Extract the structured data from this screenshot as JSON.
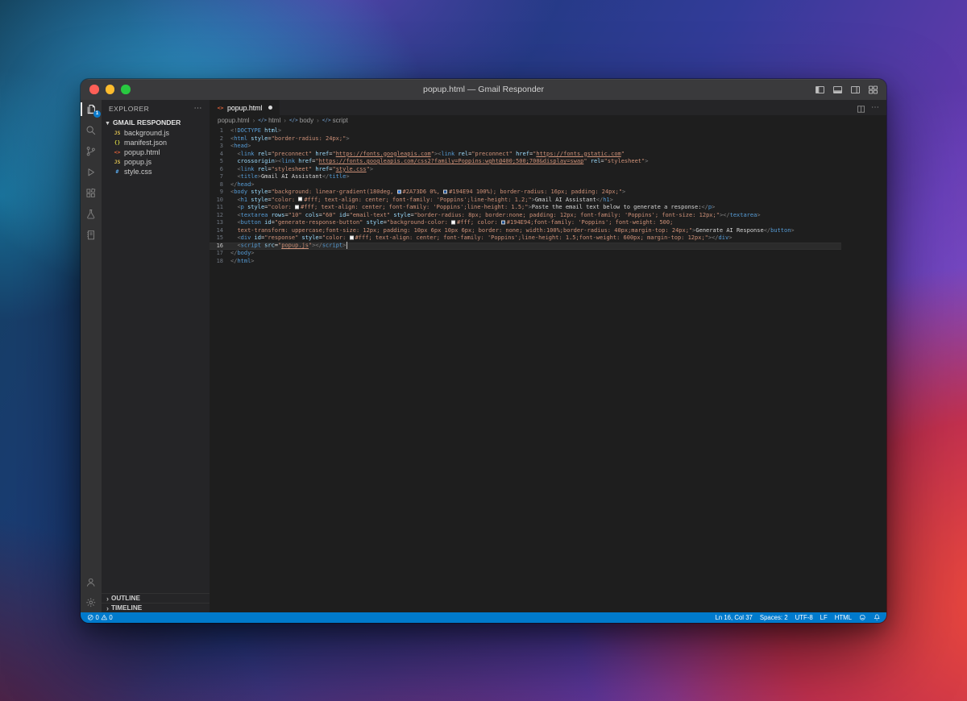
{
  "window": {
    "title": "popup.html — Gmail Responder"
  },
  "titlebar_icons": [
    "layout-sidebar-left",
    "layout-panel",
    "layout-sidebar-right",
    "layout-customize"
  ],
  "activity_bar": {
    "badge": "1",
    "items": [
      "explorer",
      "search",
      "source-control",
      "run-debug",
      "extensions",
      "testing",
      "notebook"
    ],
    "bottom_items": [
      "account",
      "settings"
    ]
  },
  "explorer": {
    "header": "EXPLORER",
    "section": "GMAIL RESPONDER",
    "files": [
      {
        "name": "background.js",
        "type": "js"
      },
      {
        "name": "manifest.json",
        "type": "json"
      },
      {
        "name": "popup.html",
        "type": "html"
      },
      {
        "name": "popup.js",
        "type": "js"
      },
      {
        "name": "style.css",
        "type": "css"
      }
    ],
    "bottom_sections": [
      "OUTLINE",
      "TIMELINE"
    ]
  },
  "editor": {
    "tab": {
      "label": "popup.html",
      "modified": true,
      "icon": "html"
    },
    "breadcrumb": [
      "popup.html",
      "html",
      "body",
      "script"
    ],
    "active_line": 16,
    "lines": [
      [
        {
          "c": "pu",
          "t": "<!"
        },
        {
          "c": "tg",
          "t": "DOCTYPE"
        },
        {
          "c": "at",
          "t": " html"
        },
        {
          "c": "pu",
          "t": ">"
        }
      ],
      [
        {
          "c": "pu",
          "t": "<"
        },
        {
          "c": "tg",
          "t": "html"
        },
        {
          "c": "at",
          "t": " style"
        },
        {
          "c": "tx",
          "t": "="
        },
        {
          "c": "st",
          "t": "\"border-radius: 24px;\""
        },
        {
          "c": "pu",
          "t": ">"
        }
      ],
      [
        {
          "c": "pu",
          "t": "<"
        },
        {
          "c": "tg",
          "t": "head"
        },
        {
          "c": "pu",
          "t": ">"
        }
      ],
      [
        {
          "c": "tx",
          "t": "  "
        },
        {
          "c": "pu",
          "t": "<"
        },
        {
          "c": "tg",
          "t": "link"
        },
        {
          "c": "at",
          "t": " rel"
        },
        {
          "c": "tx",
          "t": "="
        },
        {
          "c": "st",
          "t": "\"preconnect\""
        },
        {
          "c": "at",
          "t": " href"
        },
        {
          "c": "tx",
          "t": "="
        },
        {
          "c": "st",
          "t": "\""
        },
        {
          "c": "lk",
          "t": "https://fonts.googleapis.com"
        },
        {
          "c": "st",
          "t": "\""
        },
        {
          "c": "pu",
          "t": "><"
        },
        {
          "c": "tg",
          "t": "link"
        },
        {
          "c": "at",
          "t": " rel"
        },
        {
          "c": "tx",
          "t": "="
        },
        {
          "c": "st",
          "t": "\"preconnect\""
        },
        {
          "c": "at",
          "t": " href"
        },
        {
          "c": "tx",
          "t": "="
        },
        {
          "c": "st",
          "t": "\""
        },
        {
          "c": "lk",
          "t": "https://fonts.gstatic.com"
        },
        {
          "c": "st",
          "t": "\""
        }
      ],
      [
        {
          "c": "tx",
          "t": "  "
        },
        {
          "c": "at",
          "t": "crossorigin"
        },
        {
          "c": "pu",
          "t": "><"
        },
        {
          "c": "tg",
          "t": "link"
        },
        {
          "c": "at",
          "t": " href"
        },
        {
          "c": "tx",
          "t": "="
        },
        {
          "c": "st",
          "t": "\""
        },
        {
          "c": "lk",
          "t": "https://fonts.googleapis.com/css2?family=Poppins:wght@400;500;700&display=swap"
        },
        {
          "c": "st",
          "t": "\""
        },
        {
          "c": "at",
          "t": " rel"
        },
        {
          "c": "tx",
          "t": "="
        },
        {
          "c": "st",
          "t": "\"stylesheet\""
        },
        {
          "c": "pu",
          "t": ">"
        }
      ],
      [
        {
          "c": "tx",
          "t": "  "
        },
        {
          "c": "pu",
          "t": "<"
        },
        {
          "c": "tg",
          "t": "link"
        },
        {
          "c": "at",
          "t": " rel"
        },
        {
          "c": "tx",
          "t": "="
        },
        {
          "c": "st",
          "t": "\"stylesheet\""
        },
        {
          "c": "at",
          "t": " href"
        },
        {
          "c": "tx",
          "t": "="
        },
        {
          "c": "st",
          "t": "\""
        },
        {
          "c": "lk",
          "t": "style.css"
        },
        {
          "c": "st",
          "t": "\""
        },
        {
          "c": "pu",
          "t": ">"
        }
      ],
      [
        {
          "c": "tx",
          "t": "  "
        },
        {
          "c": "pu",
          "t": "<"
        },
        {
          "c": "tg",
          "t": "title"
        },
        {
          "c": "pu",
          "t": ">"
        },
        {
          "c": "tx",
          "t": "Gmail AI Assistant"
        },
        {
          "c": "pu",
          "t": "</"
        },
        {
          "c": "tg",
          "t": "title"
        },
        {
          "c": "pu",
          "t": ">"
        }
      ],
      [
        {
          "c": "pu",
          "t": "</"
        },
        {
          "c": "tg",
          "t": "head"
        },
        {
          "c": "pu",
          "t": ">"
        }
      ],
      [
        {
          "c": "pu",
          "t": "<"
        },
        {
          "c": "tg",
          "t": "body"
        },
        {
          "c": "at",
          "t": " style"
        },
        {
          "c": "tx",
          "t": "="
        },
        {
          "c": "st",
          "t": "\"background: linear-gradient(180deg, "
        },
        {
          "sw": "#2A73D6"
        },
        {
          "c": "st",
          "t": "#2A73D6 0%, "
        },
        {
          "sw": "#194E94"
        },
        {
          "c": "st",
          "t": "#194E94 100%); border-radius: 16px; padding: 24px;\""
        },
        {
          "c": "pu",
          "t": ">"
        }
      ],
      [
        {
          "c": "tx",
          "t": "  "
        },
        {
          "c": "pu",
          "t": "<"
        },
        {
          "c": "tg",
          "t": "h1"
        },
        {
          "c": "at",
          "t": " style"
        },
        {
          "c": "tx",
          "t": "="
        },
        {
          "c": "st",
          "t": "\"color: "
        },
        {
          "sw": "#ffffff"
        },
        {
          "c": "st",
          "t": "#fff; text-align: center; font-family: 'Poppins';line-height: 1.2;\""
        },
        {
          "c": "pu",
          "t": ">"
        },
        {
          "c": "tx",
          "t": "Gmail AI Assistant"
        },
        {
          "c": "pu",
          "t": "</"
        },
        {
          "c": "tg",
          "t": "h1"
        },
        {
          "c": "pu",
          "t": ">"
        }
      ],
      [
        {
          "c": "tx",
          "t": "  "
        },
        {
          "c": "pu",
          "t": "<"
        },
        {
          "c": "tg",
          "t": "p"
        },
        {
          "c": "at",
          "t": " style"
        },
        {
          "c": "tx",
          "t": "="
        },
        {
          "c": "st",
          "t": "\"color: "
        },
        {
          "sw": "#ffffff"
        },
        {
          "c": "st",
          "t": "#fff; text-align: center; font-family: 'Poppins';line-height: 1.5;\""
        },
        {
          "c": "pu",
          "t": ">"
        },
        {
          "c": "tx",
          "t": "Paste the email text below to generate a response:"
        },
        {
          "c": "pu",
          "t": "</"
        },
        {
          "c": "tg",
          "t": "p"
        },
        {
          "c": "pu",
          "t": ">"
        }
      ],
      [
        {
          "c": "tx",
          "t": "  "
        },
        {
          "c": "pu",
          "t": "<"
        },
        {
          "c": "tg",
          "t": "textarea"
        },
        {
          "c": "at",
          "t": " rows"
        },
        {
          "c": "tx",
          "t": "="
        },
        {
          "c": "st",
          "t": "\"10\""
        },
        {
          "c": "at",
          "t": " cols"
        },
        {
          "c": "tx",
          "t": "="
        },
        {
          "c": "st",
          "t": "\"60\""
        },
        {
          "c": "at",
          "t": " id"
        },
        {
          "c": "tx",
          "t": "="
        },
        {
          "c": "st",
          "t": "\"email-text\""
        },
        {
          "c": "at",
          "t": " style"
        },
        {
          "c": "tx",
          "t": "="
        },
        {
          "c": "st",
          "t": "\"border-radius: 8px; border:none; padding: 12px; font-family: 'Poppins'; font-size: 12px;\""
        },
        {
          "c": "pu",
          "t": "></"
        },
        {
          "c": "tg",
          "t": "textarea"
        },
        {
          "c": "pu",
          "t": ">"
        }
      ],
      [
        {
          "c": "tx",
          "t": "  "
        },
        {
          "c": "pu",
          "t": "<"
        },
        {
          "c": "tg",
          "t": "button"
        },
        {
          "c": "at",
          "t": " id"
        },
        {
          "c": "tx",
          "t": "="
        },
        {
          "c": "st",
          "t": "\"generate-response-button\""
        },
        {
          "c": "at",
          "t": " style"
        },
        {
          "c": "tx",
          "t": "="
        },
        {
          "c": "st",
          "t": "\"background-color: "
        },
        {
          "sw": "#ffffff"
        },
        {
          "c": "st",
          "t": "#fff; color: "
        },
        {
          "sw": "#194E94"
        },
        {
          "c": "st",
          "t": "#194E94;font-family: 'Poppins'; font-weight: 500;"
        }
      ],
      [
        {
          "c": "tx",
          "t": "  "
        },
        {
          "c": "st",
          "t": "text-transform: uppercase;font-size: 12px; padding: 10px 6px 10px 6px; border: none; width:100%;border-radius: 40px;margin-top: 24px;\""
        },
        {
          "c": "pu",
          "t": ">"
        },
        {
          "c": "tx",
          "t": "Generate AI Response"
        },
        {
          "c": "pu",
          "t": "</"
        },
        {
          "c": "tg",
          "t": "button"
        },
        {
          "c": "pu",
          "t": ">"
        }
      ],
      [
        {
          "c": "tx",
          "t": "  "
        },
        {
          "c": "pu",
          "t": "<"
        },
        {
          "c": "tg",
          "t": "div"
        },
        {
          "c": "at",
          "t": " id"
        },
        {
          "c": "tx",
          "t": "="
        },
        {
          "c": "st",
          "t": "\"response\""
        },
        {
          "c": "at",
          "t": " style"
        },
        {
          "c": "tx",
          "t": "="
        },
        {
          "c": "st",
          "t": "\"color: "
        },
        {
          "sw": "#ffffff"
        },
        {
          "c": "st",
          "t": "#fff; text-align: center; font-family: 'Poppins';line-height: 1.5;font-weight: 600px; margin-top: 12px;\""
        },
        {
          "c": "pu",
          "t": "></"
        },
        {
          "c": "tg",
          "t": "div"
        },
        {
          "c": "pu",
          "t": ">"
        }
      ],
      [
        {
          "c": "tx",
          "t": "  "
        },
        {
          "c": "pu",
          "t": "<"
        },
        {
          "c": "tg",
          "t": "script"
        },
        {
          "c": "at",
          "t": " src"
        },
        {
          "c": "tx",
          "t": "="
        },
        {
          "c": "st",
          "t": "\""
        },
        {
          "c": "lk",
          "t": "popup.js"
        },
        {
          "c": "st",
          "t": "\""
        },
        {
          "c": "pu",
          "t": "></"
        },
        {
          "c": "tg",
          "t": "script"
        },
        {
          "c": "pu",
          "t": ">"
        }
      ],
      [
        {
          "c": "pu",
          "t": "</"
        },
        {
          "c": "tg",
          "t": "body"
        },
        {
          "c": "pu",
          "t": ">"
        }
      ],
      [
        {
          "c": "pu",
          "t": "</"
        },
        {
          "c": "tg",
          "t": "html"
        },
        {
          "c": "pu",
          "t": ">"
        }
      ]
    ]
  },
  "status_bar": {
    "errors": "0",
    "warnings": "0",
    "cursor": "Ln 16, Col 37",
    "indent": "Spaces: 2",
    "encoding": "UTF-8",
    "eol": "LF",
    "language": "HTML"
  },
  "colors": {
    "status_bar": "#007acc",
    "accent": "#0a7acc",
    "tag": "#569cd6",
    "attribute": "#9cdcfe",
    "string": "#ce9178"
  }
}
